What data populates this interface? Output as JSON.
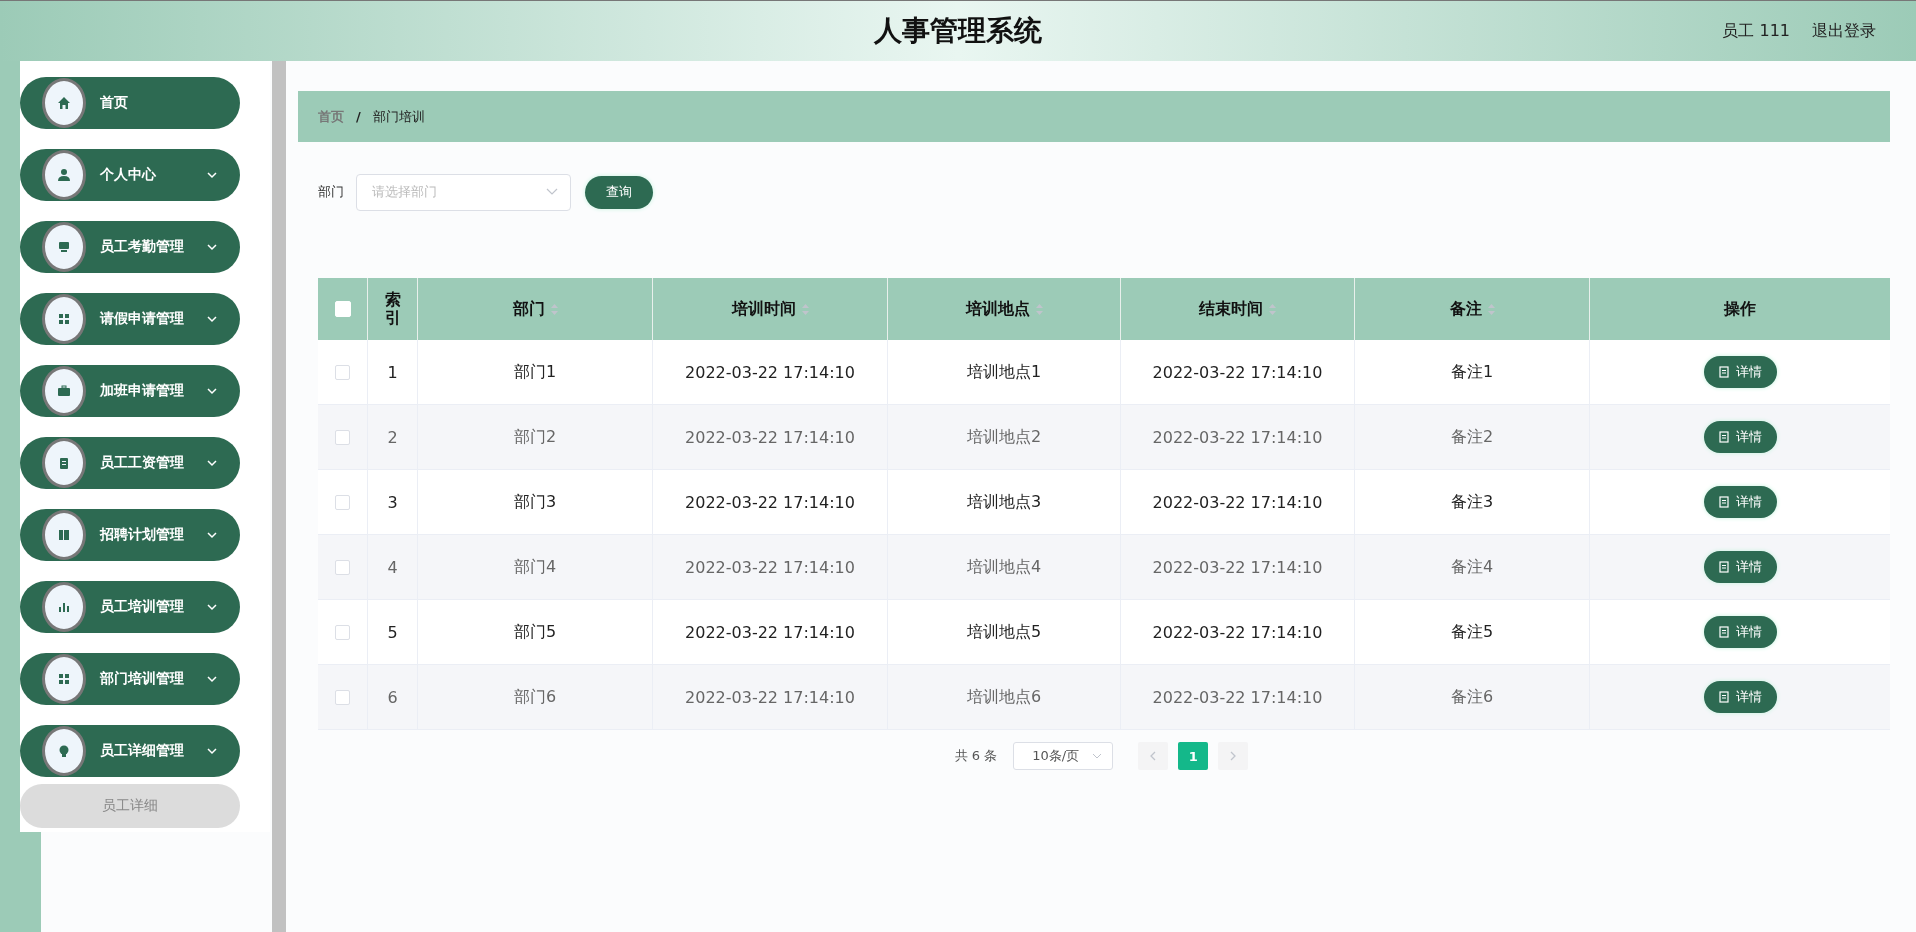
{
  "header": {
    "title": "人事管理系统",
    "user": "员工 111",
    "logout": "退出登录"
  },
  "sidebar": {
    "items": [
      {
        "label": "首页",
        "kind": "link"
      },
      {
        "label": "个人中心",
        "kind": "submenu"
      },
      {
        "label": "员工考勤管理",
        "kind": "submenu"
      },
      {
        "label": "请假申请管理",
        "kind": "submenu"
      },
      {
        "label": "加班申请管理",
        "kind": "submenu"
      },
      {
        "label": "员工工资管理",
        "kind": "submenu"
      },
      {
        "label": "招聘计划管理",
        "kind": "submenu"
      },
      {
        "label": "员工培训管理",
        "kind": "submenu"
      },
      {
        "label": "部门培训管理",
        "kind": "submenu"
      },
      {
        "label": "员工详细管理",
        "kind": "submenu",
        "children": [
          {
            "label": "员工详细",
            "selected": false
          }
        ]
      }
    ]
  },
  "breadcrumb": {
    "separator": "/",
    "items": [
      "首页",
      "部门培训"
    ]
  },
  "filter": {
    "label": "部门",
    "placeholder": "请选择部门",
    "button": "查询"
  },
  "table": {
    "header_checked": false,
    "columns": [
      {
        "label": "索引",
        "sortable": false
      },
      {
        "label": "部门",
        "sortable": true
      },
      {
        "label": "培训时间",
        "sortable": true
      },
      {
        "label": "培训地点",
        "sortable": true
      },
      {
        "label": "结束时间",
        "sortable": true
      },
      {
        "label": "备注",
        "sortable": true
      },
      {
        "label": "操作",
        "sortable": false
      }
    ],
    "rows": [
      {
        "checked": false,
        "cells": [
          "1",
          "部门1",
          "2022-03-22 17:14:10",
          "培训地点1",
          "2022-03-22 17:14:10",
          "备注1"
        ],
        "action": "详情"
      },
      {
        "checked": false,
        "cells": [
          "2",
          "部门2",
          "2022-03-22 17:14:10",
          "培训地点2",
          "2022-03-22 17:14:10",
          "备注2"
        ],
        "action": "详情"
      },
      {
        "checked": false,
        "cells": [
          "3",
          "部门3",
          "2022-03-22 17:14:10",
          "培训地点3",
          "2022-03-22 17:14:10",
          "备注3"
        ],
        "action": "详情"
      },
      {
        "checked": false,
        "cells": [
          "4",
          "部门4",
          "2022-03-22 17:14:10",
          "培训地点4",
          "2022-03-22 17:14:10",
          "备注4"
        ],
        "action": "详情"
      },
      {
        "checked": false,
        "cells": [
          "5",
          "部门5",
          "2022-03-22 17:14:10",
          "培训地点5",
          "2022-03-22 17:14:10",
          "备注5"
        ],
        "action": "详情"
      },
      {
        "checked": false,
        "cells": [
          "6",
          "部门6",
          "2022-03-22 17:14:10",
          "培训地点6",
          "2022-03-22 17:14:10",
          "备注6"
        ],
        "action": "详情"
      }
    ]
  },
  "pagination": {
    "total": "共 6 条",
    "page_size": "10条/页",
    "pages": [
      {
        "label": "1",
        "selected": true
      }
    ]
  }
}
